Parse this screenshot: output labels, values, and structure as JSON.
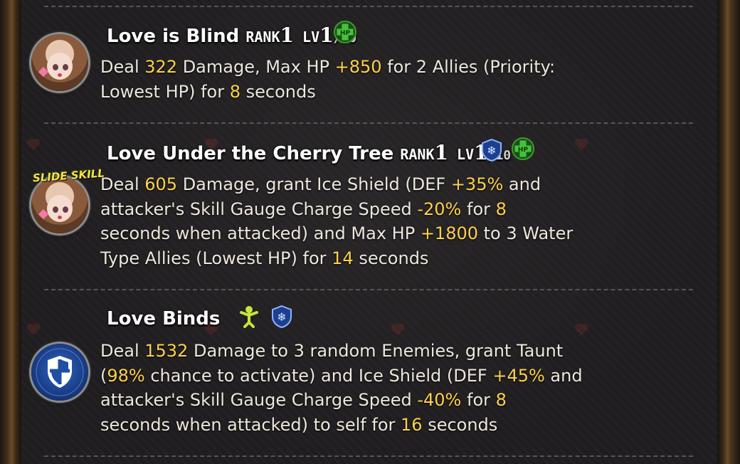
{
  "colors": {
    "highlight": "#ffd24a",
    "text": "#eee7dc",
    "title": "#ffffff",
    "frame": "#6a4c2a"
  },
  "skills": [
    {
      "title": "Love is Blind",
      "rank_label": "RANK",
      "rank": "1",
      "lv_label": "LV",
      "lv": "1",
      "lv_max": "/10",
      "icon": "portrait-icon",
      "badges": [
        "hp-heal-icon"
      ],
      "desc": [
        {
          "t": "Deal "
        },
        {
          "t": "322",
          "hl": true
        },
        {
          "t": " Damage, Max HP "
        },
        {
          "t": "+850",
          "hl": true
        },
        {
          "t": " for 2 Allies (Priority:"
        },
        {
          "br": true
        },
        {
          "t": "Lowest HP) for "
        },
        {
          "t": "8",
          "hl": true
        },
        {
          "t": " seconds"
        }
      ]
    },
    {
      "title": "Love Under the Cherry Tree",
      "rank_label": "RANK",
      "rank": "1",
      "lv_label": "LV",
      "lv": "1",
      "lv_max": "/10",
      "icon": "portrait-icon",
      "icon_label": "SLIDE SKILL",
      "badges": [
        "ice-shield-icon",
        "hp-heal-icon"
      ],
      "desc": [
        {
          "t": "Deal "
        },
        {
          "t": "605",
          "hl": true
        },
        {
          "t": " Damage, grant Ice Shield (DEF "
        },
        {
          "t": "+35%",
          "hl": true
        },
        {
          "t": " and"
        },
        {
          "br": true
        },
        {
          "t": "attacker's Skill Gauge Charge Speed "
        },
        {
          "t": "-20%",
          "hl": true
        },
        {
          "t": " for "
        },
        {
          "t": "8",
          "hl": true
        },
        {
          "br": true
        },
        {
          "t": "seconds when attacked) and Max HP "
        },
        {
          "t": "+1800",
          "hl": true
        },
        {
          "t": " to 3 Water"
        },
        {
          "br": true
        },
        {
          "t": "Type Allies (Lowest HP) for "
        },
        {
          "t": "14",
          "hl": true
        },
        {
          "t": " seconds"
        }
      ]
    },
    {
      "title": "Love Binds",
      "icon": "shield-badge-icon",
      "badges": [
        "taunt-icon",
        "ice-shield-icon"
      ],
      "desc": [
        {
          "t": "Deal "
        },
        {
          "t": "1532",
          "hl": true
        },
        {
          "t": " Damage to 3 random Enemies, grant Taunt"
        },
        {
          "br": true
        },
        {
          "t": "("
        },
        {
          "t": "98%",
          "hl": true
        },
        {
          "t": " chance to activate) and Ice Shield (DEF "
        },
        {
          "t": "+45%",
          "hl": true
        },
        {
          "t": " and"
        },
        {
          "br": true
        },
        {
          "t": "attacker's Skill Gauge Charge Speed "
        },
        {
          "t": "-40%",
          "hl": true
        },
        {
          "t": " for "
        },
        {
          "t": "8",
          "hl": true
        },
        {
          "br": true
        },
        {
          "t": "seconds when attacked) to self for "
        },
        {
          "t": "16",
          "hl": true
        },
        {
          "t": " seconds"
        }
      ]
    }
  ]
}
